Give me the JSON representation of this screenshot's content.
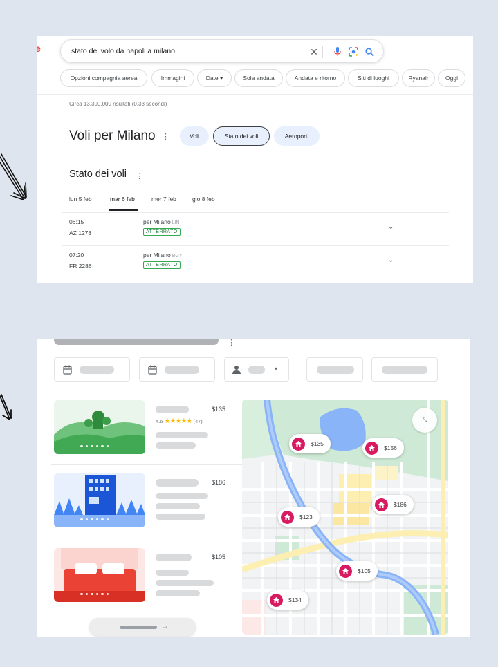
{
  "search": {
    "query": "stato del volo da napoli a milano",
    "clear_icon": "close-icon",
    "voice_icon": "mic-icon",
    "lens_icon": "lens-icon",
    "search_icon": "search-icon"
  },
  "chips": [
    "Opzioni compagnia aerea",
    "Immagini",
    "Date ▾",
    "Sola andata",
    "Andata e ritorno",
    "Siti di luoghi",
    "Ryanair",
    "Oggi"
  ],
  "results_count": "Circa 13.300.000 risultati (0,33 secondi)",
  "flights_module": {
    "title": "Voli per Milano",
    "tabs": [
      "Voli",
      "Stato dei voli",
      "Aeroporti"
    ],
    "active_tab": "Stato dei voli"
  },
  "status_section": {
    "title": "Stato dei voli",
    "days": [
      "lun 5 feb",
      "mar 6 feb",
      "mer 7 feb",
      "gio 8 feb"
    ],
    "active_day": "mar 6 feb",
    "flights": [
      {
        "time": "06:15",
        "code": "AZ 1278",
        "destination": "per Milano",
        "airport": "LIN",
        "status": "ATTERRATO"
      },
      {
        "time": "07:20",
        "code": "FR 2286",
        "destination": "per Milano",
        "airport": "BGY",
        "status": "ATTERRATO"
      }
    ]
  },
  "hotels": {
    "listings": [
      {
        "price": "$135",
        "rating": "4.6",
        "reviews": "(47)",
        "image": "park-landscape"
      },
      {
        "price": "$186",
        "image": "city-building"
      },
      {
        "price": "$105",
        "image": "bed"
      }
    ],
    "map_pins": [
      "$135",
      "$156",
      "$186",
      "$123",
      "$105",
      "$134"
    ],
    "colors": {
      "pin": "#d81b60",
      "water": "#8ab4f8",
      "park": "#ceead6",
      "road": "#fdefb2"
    }
  }
}
